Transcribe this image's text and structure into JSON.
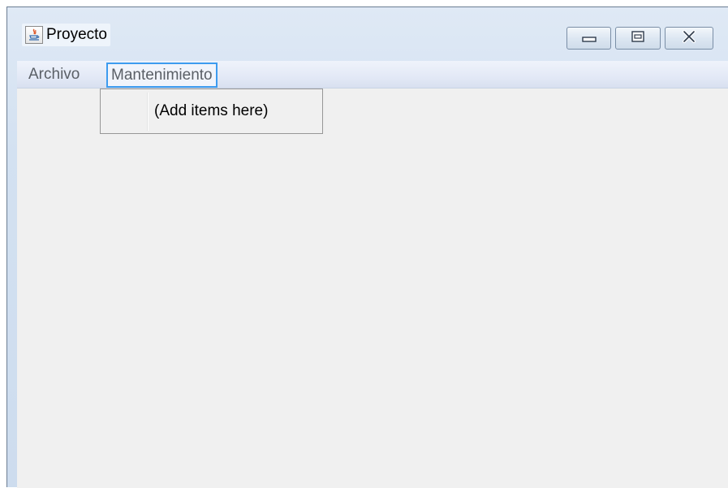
{
  "window": {
    "title": "Proyecto",
    "icon": "java-icon",
    "controls": {
      "minimize": "minimize-icon",
      "maximize": "maximize-icon",
      "close": "close-icon"
    }
  },
  "menubar": {
    "items": [
      {
        "label": "Archivo"
      },
      {
        "label": "Mantenimiento",
        "selected": true
      }
    ]
  },
  "dropdown": {
    "items": [
      {
        "label": "(Add items here)"
      }
    ]
  },
  "colors": {
    "selection_border": "#3d9bef",
    "content_background": "#f0f0f0",
    "frame_background": "#d3e1f1"
  }
}
